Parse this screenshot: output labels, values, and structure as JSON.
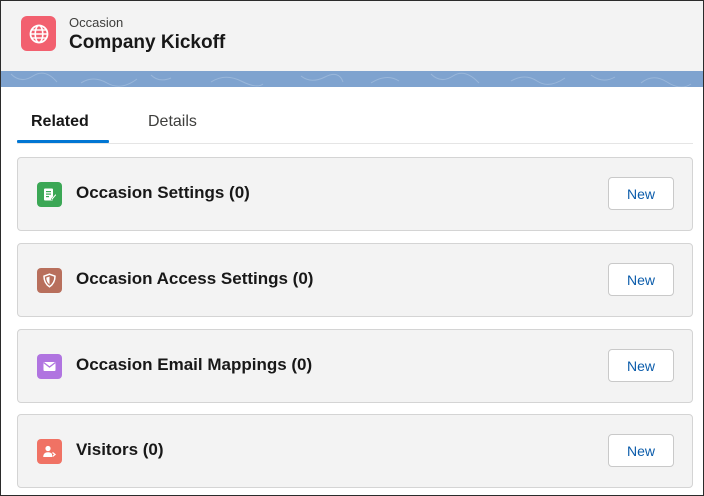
{
  "header": {
    "object_type": "Occasion",
    "record_name": "Company Kickoff",
    "icon": "globe-icon",
    "icon_color": "#f2606f",
    "banner_color": "#7fa3cf"
  },
  "tabs": [
    {
      "label": "Related",
      "active": true
    },
    {
      "label": "Details",
      "active": false
    }
  ],
  "accent_color": "#0176d3",
  "related_lists": [
    {
      "title": "Occasion Settings (0)",
      "icon": "settings-doc-icon",
      "icon_color": "#3ba755",
      "button_label": "New"
    },
    {
      "title": "Occasion Access Settings (0)",
      "icon": "shield-icon",
      "icon_color": "#b86f5c",
      "button_label": "New"
    },
    {
      "title": "Occasion Email Mappings (0)",
      "icon": "envelope-icon",
      "icon_color": "#b074e0",
      "button_label": "New"
    },
    {
      "title": "Visitors (0)",
      "icon": "visitor-icon",
      "icon_color": "#f07264",
      "button_label": "New"
    }
  ]
}
